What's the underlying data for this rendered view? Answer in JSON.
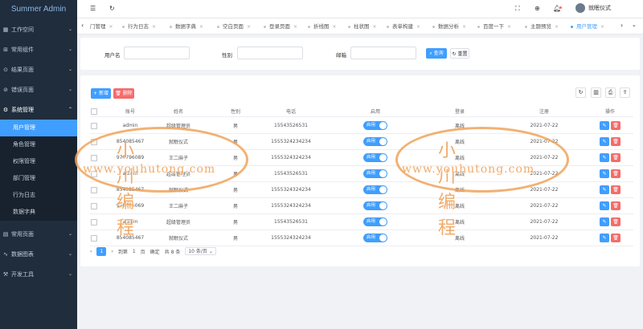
{
  "app": {
    "title": "Summer Admin"
  },
  "sidebar": {
    "items": [
      {
        "label": "工作空间",
        "icon": "dashboard-icon"
      },
      {
        "label": "常用组件",
        "icon": "component-icon"
      },
      {
        "label": "结果页面",
        "icon": "check-circle-icon"
      },
      {
        "label": "错误页面",
        "icon": "error-icon"
      },
      {
        "label": "系统管理",
        "icon": "gear-icon"
      }
    ],
    "submenu": [
      "用户管理",
      "角色管理",
      "权限管理",
      "部门管理",
      "行为日志",
      "数据字典"
    ],
    "bottom_items": [
      {
        "label": "常用页面",
        "icon": "page-icon"
      },
      {
        "label": "数据图表",
        "icon": "chart-icon"
      },
      {
        "label": "开发工具",
        "icon": "tools-icon"
      }
    ]
  },
  "header": {
    "username": "就眠仪式"
  },
  "tabs": [
    "门管理",
    "行为日志",
    "数据字典",
    "空白页面",
    "登录页面",
    "折线图",
    "柱状图",
    "表单构建",
    "数据分析",
    "百度一下",
    "主题预览",
    "用户管理"
  ],
  "search": {
    "username_label": "用户名",
    "gender_label": "性别",
    "email_label": "邮箱",
    "query_label": "查询",
    "reset_label": "重置"
  },
  "toolbar": {
    "add_label": "新增",
    "delete_label": "删除"
  },
  "table": {
    "headers": [
      "账号",
      "姓名",
      "性别",
      "电话",
      "启用",
      "登录",
      "注册",
      "操作"
    ],
    "switch_label": "启用",
    "rows": [
      [
        "admin",
        "超级管理员",
        "男",
        "15543526531",
        "离线",
        "2021-07-22"
      ],
      [
        "854085467",
        "就眠仪式",
        "男",
        "15553242342​34",
        "离线",
        "2021-07-22"
      ],
      [
        "970796089",
        "王二麻子",
        "男",
        "1555324324234",
        "离线",
        "2021-07-22"
      ],
      [
        "admin",
        "超级管理员",
        "男",
        "15543526531",
        "离线",
        "2021-07-22"
      ],
      [
        "854085467",
        "就眠仪式",
        "男",
        "1555324324234",
        "离线",
        "2021-07-22"
      ],
      [
        "970796069",
        "王二麻子",
        "男",
        "1555324324234",
        "离线",
        "2021-07-22"
      ],
      [
        "admin",
        "超级管理员",
        "男",
        "15543526531",
        "离线",
        "2021-07-22"
      ],
      [
        "854085467",
        "就眠仪式",
        "男",
        "1555324324234",
        "离线",
        "2021-07-22"
      ]
    ]
  },
  "pagination": {
    "current": "1",
    "goto_label": "到第",
    "page_input": "1",
    "page_unit": "页",
    "confirm_label": "确定",
    "total_label": "共 8 条",
    "page_size": "10 条/页"
  },
  "watermark": {
    "title": "小川编程",
    "url": "www.youhutong.com"
  },
  "colors": {
    "primary": "#409eff",
    "danger": "#f56c6c",
    "sidebar": "#1f2d3d",
    "watermark": "#f0a35a"
  }
}
